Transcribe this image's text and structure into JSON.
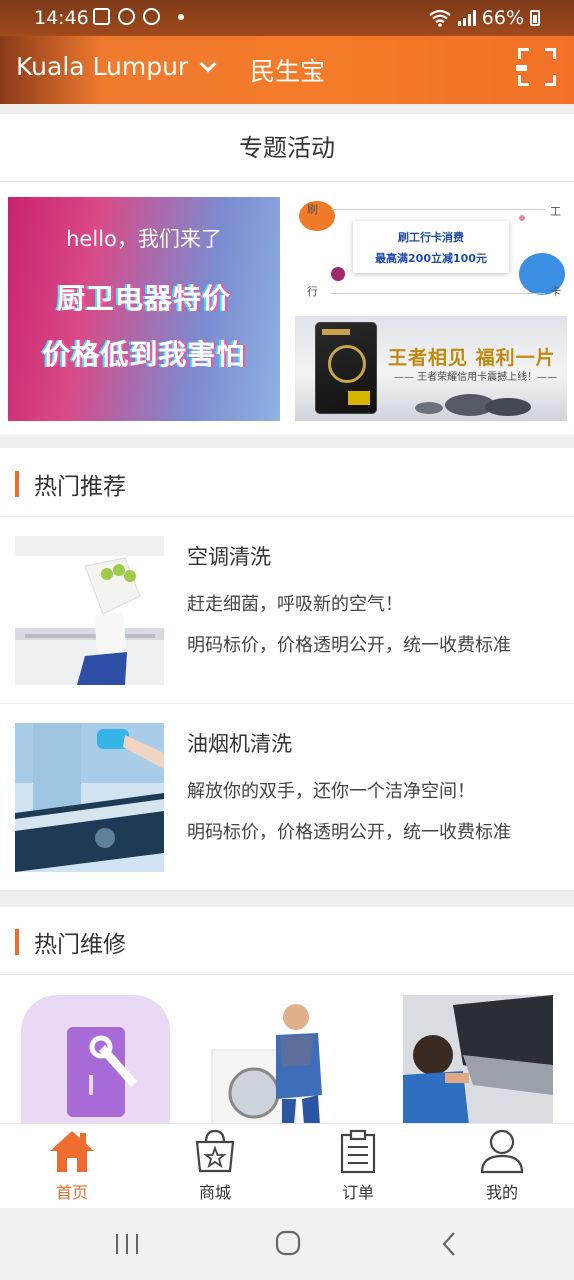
{
  "status": {
    "time": "14:46",
    "battery": "66%"
  },
  "header": {
    "city": "Kuala Lumpur",
    "brand": "民生宝"
  },
  "special": {
    "title": "专题活动",
    "banner_main": {
      "hello": "hello，我们来了",
      "line1": "厨卫电器特价",
      "line2": "价格低到我害怕"
    },
    "banner_r1": {
      "line1": "刷工行卡消费",
      "line2": "最高满200立减100元",
      "c1": "刷",
      "c2": "工",
      "c3": "行",
      "c4": "卡"
    },
    "banner_r2": {
      "title": "王者相见 福利一片",
      "sub": "—— 王者荣耀信用卡震撼上线！——"
    }
  },
  "hot_recommend": {
    "title": "热门推荐",
    "items": [
      {
        "title": "空调清洗",
        "desc1": "赶走细菌，呼吸新的空气！",
        "desc2": "明码标价，价格透明公开，统一收费标准"
      },
      {
        "title": "油烟机清洗",
        "desc1": "解放你的双手，还你一个洁净空间！",
        "desc2": "明码标价，价格透明公开，统一收费标准"
      }
    ]
  },
  "hot_repair": {
    "title": "热门维修"
  },
  "bottom_nav": [
    {
      "label": "首页",
      "icon": "home-icon"
    },
    {
      "label": "商城",
      "icon": "shopping-bag-icon"
    },
    {
      "label": "订单",
      "icon": "clipboard-icon"
    },
    {
      "label": "我的",
      "icon": "user-icon"
    }
  ],
  "colors": {
    "accent": "#ee6d2e",
    "header": "#f47b28"
  }
}
